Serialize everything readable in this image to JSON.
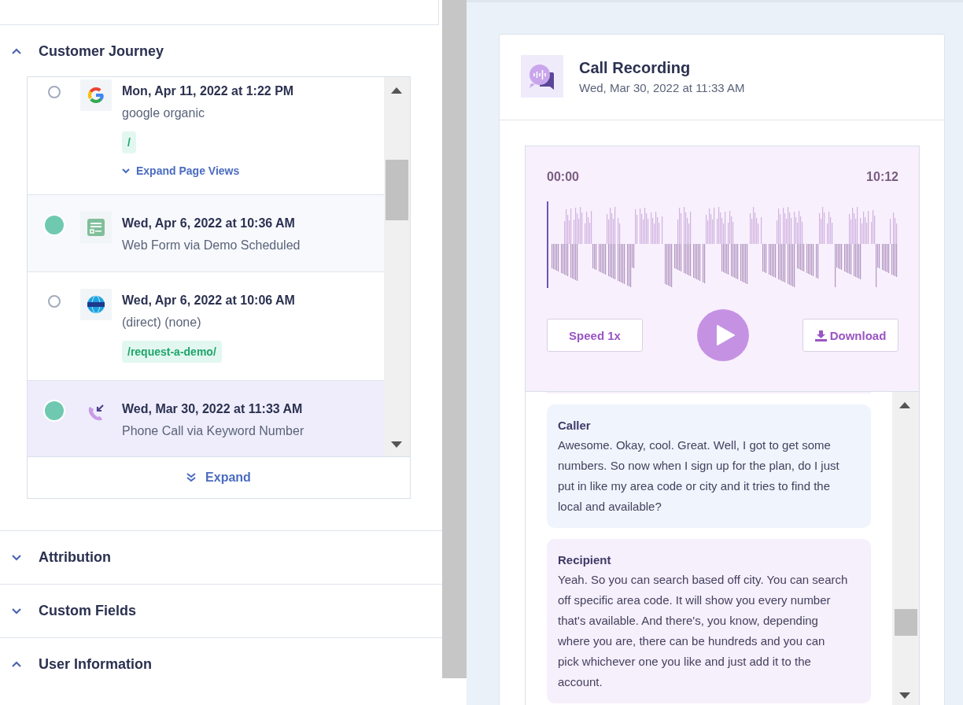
{
  "sections": [
    {
      "title": "Customer Journey",
      "expanded": true,
      "journey": {
        "expand_label": "Expand",
        "events": [
          {
            "kind": "google",
            "date": "Mon, Apr 11, 2022 at 1:22 PM",
            "source": "google organic",
            "milestone": false,
            "selected": false,
            "tags": [
              "/"
            ],
            "link": "Expand Page Views"
          },
          {
            "kind": "form",
            "date": "Wed, Apr 6, 2022 at 10:36 AM",
            "source": "Web Form via Demo Scheduled",
            "milestone": true,
            "selected": false
          },
          {
            "kind": "web",
            "date": "Wed, Apr 6, 2022 at 10:06 AM",
            "source": "(direct) (none)",
            "milestone": false,
            "selected": false,
            "tags": [
              "/request-a-demo/"
            ]
          },
          {
            "kind": "call",
            "date": "Wed, Mar 30, 2022 at 11:33 AM",
            "source": "Phone Call via Keyword Number",
            "milestone": true,
            "selected": true
          }
        ]
      }
    },
    {
      "title": "Attribution",
      "expanded": false
    },
    {
      "title": "Custom Fields",
      "expanded": false
    },
    {
      "title": "User Information",
      "expanded": true
    }
  ],
  "recording": {
    "title": "Call Recording",
    "date": "Wed, Mar 30, 2022 at 11:33 AM",
    "time_start": "00:00",
    "time_end": "10:12",
    "speed_label": "Speed 1x",
    "download_label": "Download",
    "transcript": [
      {
        "kind": "caller",
        "speaker": "Caller",
        "text": "Awesome. Okay, cool. Great. Well, I got to get some numbers. So now when I sign up for the plan, do I just put in like my area code or city and it tries to find the local and available?"
      },
      {
        "kind": "recipient",
        "speaker": "Recipient",
        "text": "Yeah. So you can search based off city. You can search off specific area code. It will show you every number that's available. And there's, you know, depending where you are, there can be hundreds and you can pick whichever one you like and just add it to the account."
      }
    ]
  }
}
